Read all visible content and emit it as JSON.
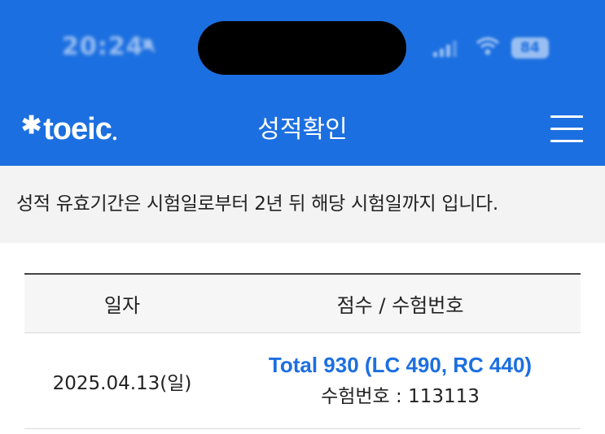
{
  "status_bar": {
    "time": "20:24",
    "battery": "84"
  },
  "header": {
    "logo_text": "toeic",
    "title": "성적확인"
  },
  "notice": {
    "text": "성적 유효기간은 시험일로부터 2년 뒤 해당 시험일까지 입니다."
  },
  "table": {
    "headers": [
      "일자",
      "점수 / 수험번호"
    ],
    "rows": [
      {
        "date": "2025.04.13(일)",
        "score": "Total 930 (LC 490, RC 440)",
        "exam_label": "수험번호 : ",
        "exam_number": "113113"
      }
    ]
  },
  "colors": {
    "brand": "#1c6fe0",
    "score": "#1c6fe0"
  }
}
